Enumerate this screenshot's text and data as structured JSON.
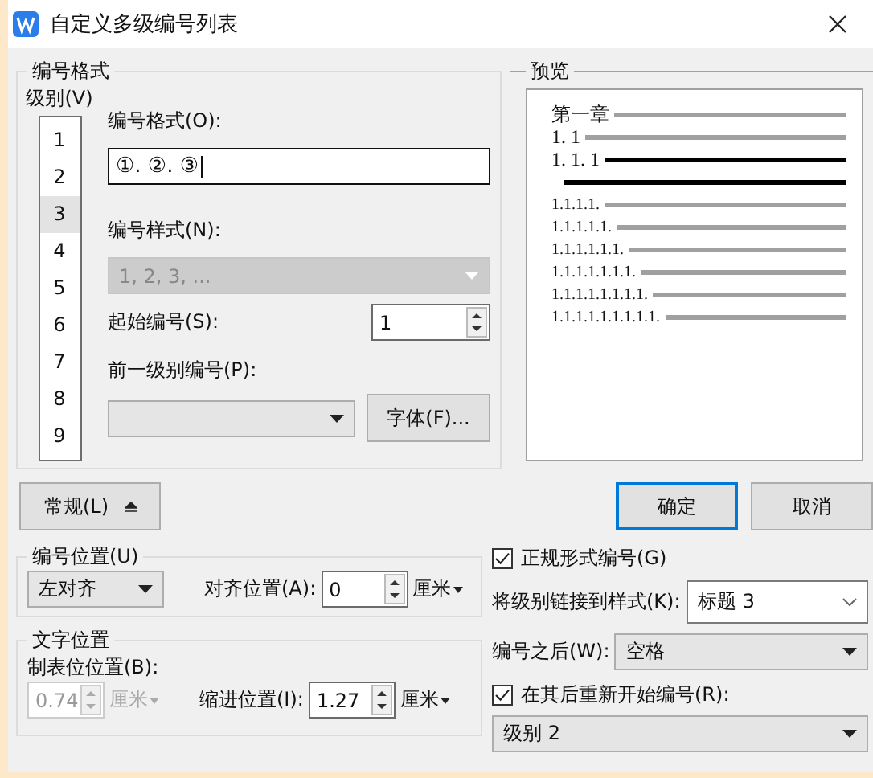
{
  "window": {
    "title": "自定义多级编号列表"
  },
  "number_format": {
    "title": "编号格式",
    "level_label": "级别(V)",
    "levels": [
      {
        "label": "1",
        "selected": false
      },
      {
        "label": "2",
        "selected": false
      },
      {
        "label": "3",
        "selected": true
      },
      {
        "label": "4",
        "selected": false
      },
      {
        "label": "5",
        "selected": false
      },
      {
        "label": "6",
        "selected": false
      },
      {
        "label": "7",
        "selected": false
      },
      {
        "label": "8",
        "selected": false
      },
      {
        "label": "9",
        "selected": false
      }
    ],
    "format_label": "编号格式(O):",
    "format_value": "①. ②. ③",
    "style_label": "编号样式(N):",
    "style_value": "1, 2, 3, ...",
    "style_disabled": true,
    "start_label": "起始编号(S):",
    "start_value": "1",
    "prev_label": "前一级别编号(P):",
    "font_button": "字体(F)..."
  },
  "preview": {
    "title": "预览",
    "lines": [
      {
        "text": "第一章",
        "current": false,
        "small": false
      },
      {
        "text": "1. 1",
        "current": false,
        "small": false
      },
      {
        "text": "1. 1. 1",
        "current": true,
        "small": false
      },
      {
        "text": "1.1.1.1.",
        "current": false,
        "small": true
      },
      {
        "text": "1.1.1.1.1.",
        "current": false,
        "small": true
      },
      {
        "text": "1.1.1.1.1.1.",
        "current": false,
        "small": true
      },
      {
        "text": "1.1.1.1.1.1.1.",
        "current": false,
        "small": true
      },
      {
        "text": "1.1.1.1.1.1.1.1.",
        "current": false,
        "small": true
      },
      {
        "text": "1.1.1.1.1.1.1.1.1.",
        "current": false,
        "small": true
      }
    ]
  },
  "more_button": "常规(L)",
  "ok_button": "确定",
  "cancel_button": "取消",
  "number_position": {
    "title": "编号位置(U)",
    "align_value": "左对齐",
    "at_label": "对齐位置(A):",
    "at_value": "0",
    "unit": "厘米"
  },
  "text_position": {
    "title": "文字位置",
    "tab_label": "制表位位置(B):",
    "tab_value": "0.74",
    "tab_disabled": true,
    "tab_unit": "厘米",
    "indent_label": "缩进位置(I):",
    "indent_value": "1.27",
    "indent_unit": "厘米"
  },
  "options": {
    "legal": {
      "label": "正规形式编号(G)",
      "checked": true
    },
    "link_label": "将级别链接到样式(K):",
    "link_value": "标题 3",
    "follow_label": "编号之后(W):",
    "follow_value": "空格",
    "restart": {
      "label": "在其后重新开始编号(R):",
      "checked": true
    },
    "restart_value": "级别 2"
  }
}
